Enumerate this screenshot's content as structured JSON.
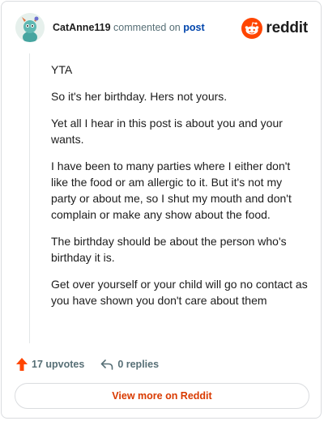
{
  "header": {
    "username": "CatAnne119",
    "action_text": "commented on",
    "post_link": "post",
    "logo_text": "reddit"
  },
  "comment": {
    "paragraphs": [
      "YTA",
      "So it's her birthday. Hers not yours.",
      "Yet all I hear in this post is about you and your wants.",
      "I have been to many parties where I either don't like the food or am allergic to it. But it's not my party or about me, so I shut my mouth and don't complain or make any show about the food.",
      "The birthday should be about the person who's birthday it is.",
      "Get over yourself or your child will go no contact as you have shown you don't care about them"
    ]
  },
  "footer": {
    "upvotes": "17 upvotes",
    "replies": "0 replies"
  },
  "cta": {
    "label": "View more on Reddit"
  },
  "colors": {
    "accent": "#d93a00",
    "upvote": "#ff4500",
    "link": "#0045ac"
  }
}
